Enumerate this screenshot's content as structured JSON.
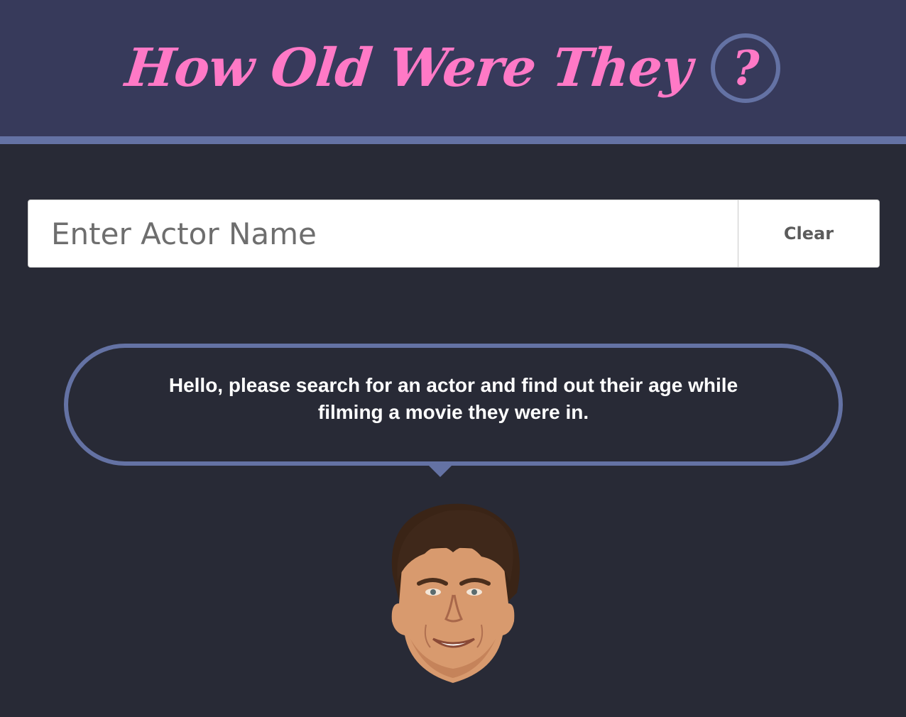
{
  "header": {
    "title": "How Old Were They",
    "help_symbol": "?",
    "colors": {
      "background": "#373a5b",
      "accent": "#6472a4",
      "title": "#ff79c6"
    }
  },
  "search": {
    "placeholder": "Enter Actor Name",
    "value": "",
    "clear_label": "Clear"
  },
  "message": {
    "text": "Hello, please search for an actor and find out their age while filming a movie they were in."
  },
  "avatar": {
    "icon": "actor-face-icon"
  },
  "page": {
    "background": "#282a36"
  }
}
